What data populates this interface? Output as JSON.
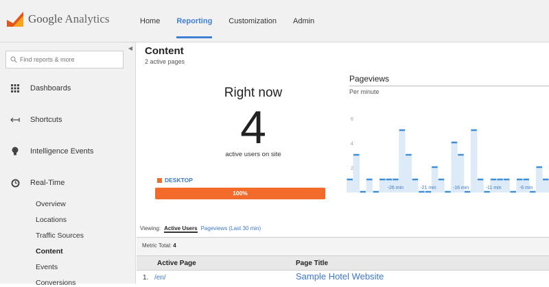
{
  "app": {
    "brand_google": "Google",
    "brand_product": "Analytics"
  },
  "nav": {
    "items": [
      {
        "label": "Home",
        "active": false
      },
      {
        "label": "Reporting",
        "active": true
      },
      {
        "label": "Customization",
        "active": false
      },
      {
        "label": "Admin",
        "active": false
      }
    ]
  },
  "sidebar": {
    "search_placeholder": "Find reports & more",
    "items": [
      {
        "label": "Dashboards",
        "icon": "grid-icon"
      },
      {
        "label": "Shortcuts",
        "icon": "shortcut-arrow-icon"
      },
      {
        "label": "Intelligence Events",
        "icon": "lightbulb-icon"
      },
      {
        "label": "Real-Time",
        "icon": "clock-icon"
      }
    ],
    "sub_items": [
      {
        "label": "Overview",
        "active": false
      },
      {
        "label": "Locations",
        "active": false
      },
      {
        "label": "Traffic Sources",
        "active": false
      },
      {
        "label": "Content",
        "active": true
      },
      {
        "label": "Events",
        "active": false
      },
      {
        "label": "Conversions",
        "active": false
      }
    ]
  },
  "main": {
    "title": "Content",
    "subtitle": "2 active pages",
    "right_now": {
      "label": "Right now",
      "count": "4",
      "caption": "active users on site",
      "device_label": "DESKTOP",
      "device_percent": "100%",
      "device_fraction": 1.0
    },
    "pageviews": {
      "title": "Pageviews",
      "subtitle": "Per minute"
    },
    "viewing": {
      "label": "Viewing:",
      "active_tab": "Active Users",
      "other_tab": "Pageviews (Last 30 min)"
    },
    "metric": {
      "label": "Metric Total:",
      "value": "4"
    },
    "table": {
      "headers": [
        "Active Page",
        "Page Title"
      ],
      "rows": [
        {
          "num": "1.",
          "page": "/en/",
          "title": "Sample Hotel Website"
        }
      ]
    }
  },
  "colors": {
    "accent": "#3f7fd6",
    "device_bar": "#f26b2b",
    "chart_line": "#3d8fd9",
    "chart_fill": "#dcebf7"
  },
  "chart_data": {
    "type": "bar",
    "title": "Pageviews",
    "subtitle": "Per minute",
    "x_tick_labels": [
      "-26 min",
      "-21 min",
      "-16 min",
      "-11 min",
      "-6 min"
    ],
    "ylim": [
      0,
      6
    ],
    "y_ticks": [
      "2",
      "4",
      "6"
    ],
    "values": [
      1,
      3,
      0,
      1,
      0,
      1,
      1,
      1,
      5,
      3,
      1,
      0,
      0,
      2,
      1,
      0,
      4,
      3,
      0,
      5,
      1,
      0,
      1,
      1,
      1,
      0,
      1,
      1,
      0,
      2,
      1
    ]
  }
}
